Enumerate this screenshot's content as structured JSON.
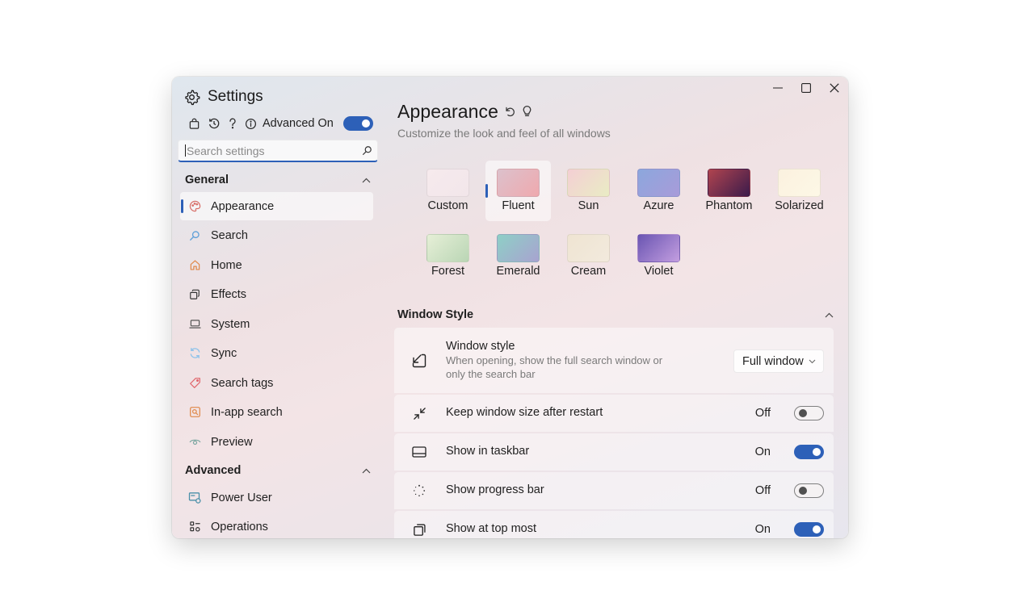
{
  "app": {
    "title": "Settings"
  },
  "topbar": {
    "advanced_label": "Advanced On",
    "advanced_on": true
  },
  "search": {
    "placeholder": "Search settings",
    "value": ""
  },
  "sidebar": {
    "sections": [
      {
        "label": "General",
        "items": [
          {
            "label": "Appearance",
            "icon": "palette-icon",
            "selected": true
          },
          {
            "label": "Search",
            "icon": "search-icon"
          },
          {
            "label": "Home",
            "icon": "home-icon"
          },
          {
            "label": "Effects",
            "icon": "copy-icon"
          },
          {
            "label": "System",
            "icon": "laptop-icon"
          },
          {
            "label": "Sync",
            "icon": "sync-icon"
          },
          {
            "label": "Search tags",
            "icon": "tag-icon"
          },
          {
            "label": "In-app search",
            "icon": "in-app-search-icon"
          },
          {
            "label": "Preview",
            "icon": "eye-icon"
          }
        ]
      },
      {
        "label": "Advanced",
        "items": [
          {
            "label": "Power User",
            "icon": "power-user-icon"
          },
          {
            "label": "Operations",
            "icon": "operations-icon"
          }
        ]
      }
    ]
  },
  "page": {
    "title": "Appearance",
    "subtitle": "Customize the look and feel of all windows"
  },
  "themes": [
    {
      "label": "Custom",
      "colors": [
        "#f6eaed",
        "#f2e6ea"
      ]
    },
    {
      "label": "Fluent",
      "colors": [
        "#dcc1cc",
        "#efa9ae"
      ],
      "selected": true
    },
    {
      "label": "Sun",
      "colors": [
        "#f4cfd4",
        "#e9ecc4"
      ]
    },
    {
      "label": "Azure",
      "colors": [
        "#8ca7dd",
        "#a89bd9"
      ]
    },
    {
      "label": "Phantom",
      "colors": [
        "#b0444f",
        "#3b1b4b"
      ]
    },
    {
      "label": "Solarized",
      "colors": [
        "#fbf1df",
        "#fdf8e6"
      ]
    },
    {
      "label": "Forest",
      "colors": [
        "#e6efd7",
        "#bad6b5"
      ]
    },
    {
      "label": "Emerald",
      "colors": [
        "#8ecfc6",
        "#a8a3d0"
      ]
    },
    {
      "label": "Cream",
      "colors": [
        "#efe4d2",
        "#f2eadd"
      ]
    },
    {
      "label": "Violet",
      "colors": [
        "#6a55b2",
        "#c39ee0"
      ]
    }
  ],
  "window_style": {
    "section_label": "Window Style",
    "rows": [
      {
        "title": "Window style",
        "description": "When opening, show the full search window or only the search bar",
        "icon": "arrow-down-left-icon",
        "control": "dropdown",
        "value": "Full window"
      },
      {
        "title": "Keep window size after restart",
        "icon": "shrink-icon",
        "control": "toggle",
        "state": "Off",
        "on": false
      },
      {
        "title": "Show in taskbar",
        "icon": "taskbar-icon",
        "control": "toggle",
        "state": "On",
        "on": true
      },
      {
        "title": "Show progress bar",
        "icon": "progress-spinner-icon",
        "control": "toggle",
        "state": "Off",
        "on": false
      },
      {
        "title": "Show at top most",
        "icon": "windows-stack-icon",
        "control": "toggle",
        "state": "On",
        "on": true
      }
    ]
  },
  "colors": {
    "accent": "#2d60b8",
    "text": "#1f1f1f",
    "muted": "#7a7a7a"
  }
}
